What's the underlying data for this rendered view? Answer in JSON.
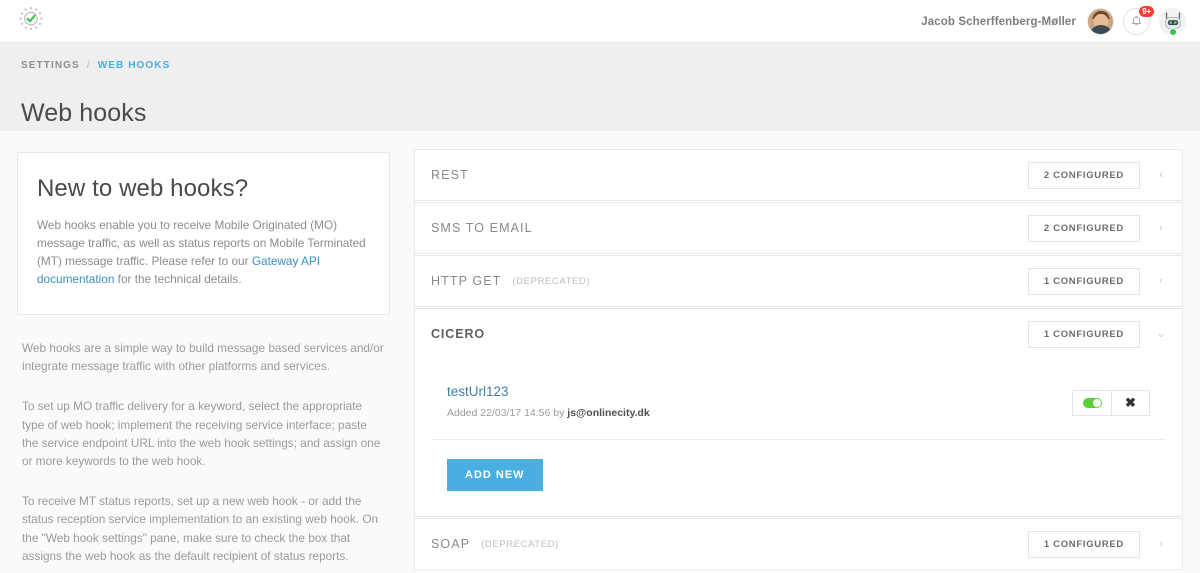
{
  "header": {
    "logo_icon": "check-badge-stars-logo",
    "user_name": "Jacob Scherffenberg-Møller",
    "avatar_icon": "user-avatar",
    "notifications_icon": "bell-icon",
    "notifications_badge": "9+",
    "bot_icon": "robot-avatar",
    "bot_status": "online"
  },
  "breadcrumb": {
    "parent": "SETTINGS",
    "separator": "/",
    "current": "WEB HOOKS"
  },
  "page": {
    "title": "Web hooks"
  },
  "info_card": {
    "heading": "New to web hooks?",
    "body_before_link": "Web hooks enable you to receive Mobile Originated (MO) message traffic, as well as status reports on Mobile Terminated (MT) message traffic. Please refer to our ",
    "link_text": "Gateway API documentation",
    "body_after_link": " for the technical details."
  },
  "prose": {
    "paragraphs": [
      "Web hooks are a simple way to build message based services and/or integrate message traffic with other platforms and services.",
      "To set up MO traffic delivery for a keyword, select the appropriate type of web hook; implement the receiving service interface; paste the service endpoint URL into the web hook settings; and assign one or more keywords to the web hook.",
      "To receive MT status reports, set up a new web hook - or add the status reception service implementation to an existing web hook. On the \"Web hook settings\" pane, make sure to check the box that assigns the web hook as the default recipient of status reports."
    ]
  },
  "hooks": [
    {
      "name": "REST",
      "deprecated_label": "",
      "configured_label": "2 CONFIGURED",
      "chevron": "‹",
      "expanded": false
    },
    {
      "name": "SMS TO EMAIL",
      "deprecated_label": "",
      "configured_label": "2 CONFIGURED",
      "chevron": "‹",
      "expanded": false
    },
    {
      "name": "HTTP GET",
      "deprecated_label": "(DEPRECATED)",
      "configured_label": "1 CONFIGURED",
      "chevron": "‹",
      "expanded": false
    },
    {
      "name": "CICERO",
      "deprecated_label": "",
      "configured_label": "1 CONFIGURED",
      "chevron": "⌄",
      "expanded": true
    },
    {
      "name": "SOAP",
      "deprecated_label": "(DEPRECATED)",
      "configured_label": "1 CONFIGURED",
      "chevron": "‹",
      "expanded": false
    }
  ],
  "cicero_item": {
    "url": "testUrl123",
    "added_prefix": "Added 22/03/17 14:56 by ",
    "added_user": "js@onlinecity.dk",
    "toggle_state": "on",
    "toggle_icon": "toggle-on-icon",
    "delete_icon": "close-x-icon"
  },
  "buttons": {
    "add_new": "ADD NEW"
  },
  "colors": {
    "accent_blue": "#4aaee0",
    "link_blue": "#3c8dbc",
    "toggle_green": "#5ed037",
    "badge_red": "#f04134",
    "band_gray": "#efefef"
  }
}
